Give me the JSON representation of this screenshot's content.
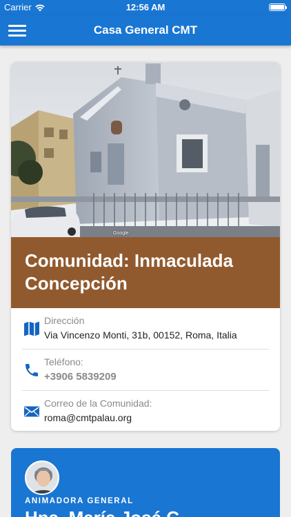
{
  "status_bar": {
    "carrier": "Carrier",
    "time": "12:56 AM"
  },
  "app_bar": {
    "title": "Casa General CMT",
    "menu_icon": "hamburger-menu-icon"
  },
  "community": {
    "title": "Comunidad: Inmaculada Concepción",
    "photo_credit": "Google",
    "accent_color": "#915a2e",
    "address": {
      "icon": "map-icon",
      "label": "Dirección",
      "value": "Via Vincenzo Monti, 31b, 00152, Roma, Italia"
    },
    "phone": {
      "icon": "phone-icon",
      "label": "Teléfono:",
      "value": "+3906 5839209"
    },
    "email": {
      "icon": "mail-icon",
      "label": "Correo de la Comunidad:",
      "value": "roma@cmtpalau.org"
    }
  },
  "leader": {
    "role": "ANIMADORA GENERAL",
    "name": "Hna. María José C...",
    "accent_color": "#1976d2"
  },
  "colors": {
    "primary": "#1976d2",
    "icon_blue": "#1565c0",
    "background": "#eeeeee"
  }
}
